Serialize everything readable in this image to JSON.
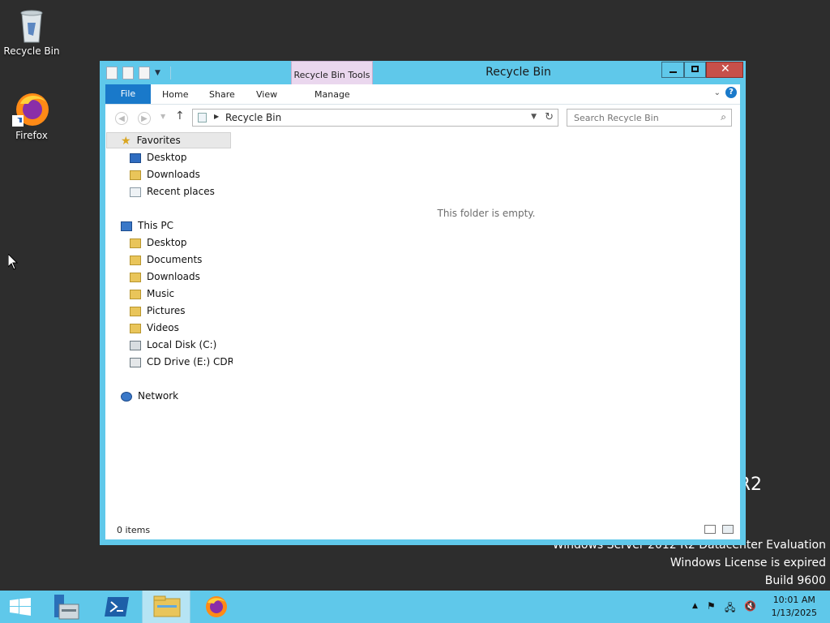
{
  "desktop": {
    "icons": [
      {
        "label": "Recycle Bin"
      },
      {
        "label": "Firefox"
      }
    ],
    "watermark": {
      "edition_partial": "R2",
      "line1": "Windows Server 2012 R2 Datacenter Evaluation",
      "line2": "Windows License is expired",
      "line3": "Build 9600"
    }
  },
  "window": {
    "title": "Recycle Bin",
    "contextual_tab_group": "Recycle Bin Tools",
    "ribbon_tabs": {
      "file": "File",
      "home": "Home",
      "share": "Share",
      "view": "View",
      "manage": "Manage"
    },
    "address": {
      "path": "Recycle Bin"
    },
    "search": {
      "placeholder": "Search Recycle Bin"
    },
    "nav": {
      "favorites": {
        "label": "Favorites",
        "items": [
          "Desktop",
          "Downloads",
          "Recent places"
        ]
      },
      "this_pc": {
        "label": "This PC",
        "items": [
          "Desktop",
          "Documents",
          "Downloads",
          "Music",
          "Pictures",
          "Videos",
          "Local Disk (C:)",
          "CD Drive (E:) CDROM"
        ]
      },
      "network": {
        "label": "Network"
      }
    },
    "empty_message": "This folder is empty.",
    "status": "0 items"
  },
  "taskbar": {
    "clock": {
      "time": "10:01 AM",
      "date": "1/13/2025"
    }
  },
  "colors": {
    "window_frame": "#5fc8ea",
    "file_tab": "#1979ca",
    "context_tab": "#ead7ee",
    "close_button": "#c7504a",
    "desktop": "#2d2d2d"
  }
}
